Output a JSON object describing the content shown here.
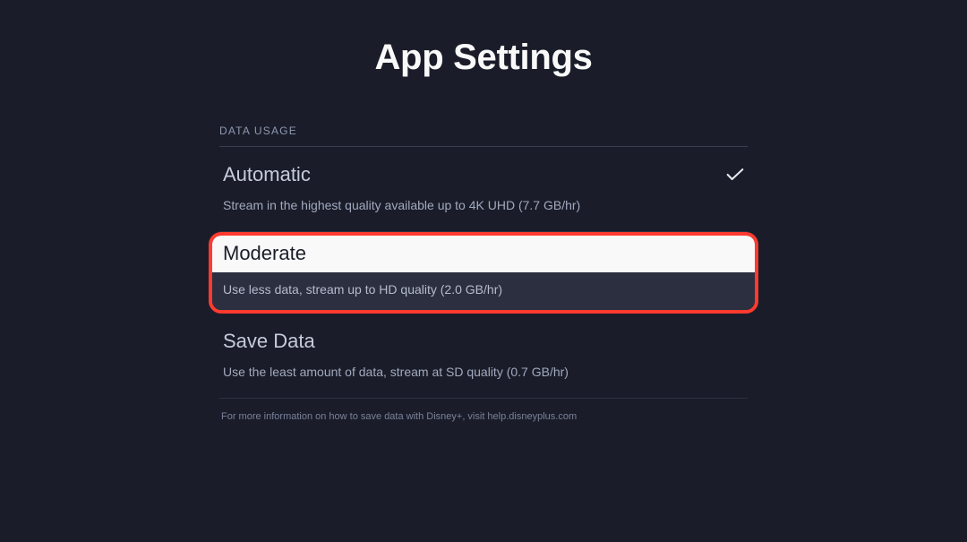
{
  "page": {
    "title": "App Settings"
  },
  "section": {
    "header": "DATA USAGE"
  },
  "options": {
    "automatic": {
      "title": "Automatic",
      "desc": "Stream in the highest quality available up to 4K UHD (7.7 GB/hr)",
      "selected": true
    },
    "moderate": {
      "title": "Moderate",
      "desc": "Use less data, stream up to HD quality (2.0 GB/hr)",
      "highlighted": true
    },
    "save_data": {
      "title": "Save Data",
      "desc": "Use the least amount of data, stream at SD quality (0.7 GB/hr)"
    }
  },
  "footer": {
    "note": "For more information on how to save data with Disney+, visit help.disneyplus.com"
  }
}
